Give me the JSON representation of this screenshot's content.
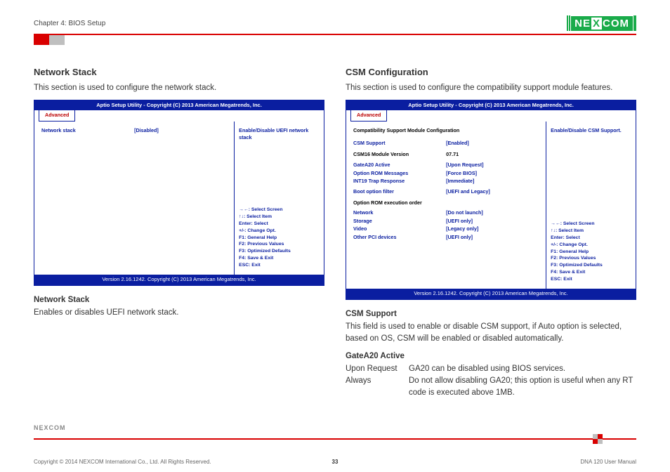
{
  "header": {
    "chapter": "Chapter 4: BIOS Setup",
    "brand_left": "NE",
    "brand_x": "X",
    "brand_right": "COM"
  },
  "left": {
    "title": "Network Stack",
    "intro": "This section is used to configure the network stack.",
    "sub_title": "Network Stack",
    "sub_text": "Enables or disables UEFI network stack."
  },
  "right": {
    "title": "CSM Configuration",
    "intro": "This section is used to configure the compatibility support module features.",
    "sub1_title": "CSM Support",
    "sub1_text": "This field is used to enable or disable CSM support, if Auto option is selected, based on OS, CSM will be enabled or disabled automatically.",
    "sub2_title": "GateA20 Active",
    "kv1_k": "Upon Request",
    "kv1_v": "GA20 can be disabled using BIOS services.",
    "kv2_k": "Always",
    "kv2_v": "Do not allow disabling GA20; this option is useful when any RT code is executed above 1MB."
  },
  "bios_common": {
    "top": "Aptio Setup Utility - Copyright (C) 2013 American Megatrends, Inc.",
    "tab": "Advanced",
    "bottom": "Version 2.16.1242. Copyright (C) 2013 American Megatrends, Inc.",
    "nav": {
      "l1": "→←: Select Screen",
      "l2": "↑↓: Select Item",
      "l3": "Enter: Select",
      "l4": "+/-: Change Opt.",
      "l5": "F1: General Help",
      "l6": "F2: Previous Values",
      "l7": "F3: Optimized Defaults",
      "l8": "F4: Save & Exit",
      "l9": "ESC: Exit"
    }
  },
  "bios_left": {
    "help": "Enable/Disable UEFI network stack",
    "r1_k": "Network stack",
    "r1_v": "[Disabled]"
  },
  "bios_right": {
    "help": "Enable/Disable CSM Support.",
    "heading": "Compatibility Support Module Configuration",
    "r1_k": "CSM Support",
    "r1_v": "[Enabled]",
    "r2_k": "CSM16 Module Version",
    "r2_v": "07.71",
    "r3_k": "GateA20 Active",
    "r3_v": "[Upon Request]",
    "r4_k": "Option ROM Messages",
    "r4_v": "[Force BIOS]",
    "r5_k": "INT19 Trap Response",
    "r5_v": "[Immediate]",
    "r6_k": "Boot option filter",
    "r6_v": "[UEFI and Legacy]",
    "r7_k": "Option ROM execution order",
    "r8_k": "Network",
    "r8_v": "[Do not launch]",
    "r9_k": "Storage",
    "r9_v": "[UEFI only]",
    "r10_k": "Video",
    "r10_v": "[Legacy only]",
    "r11_k": "Other PCI devices",
    "r11_v": "[UEFI only]"
  },
  "footer": {
    "brand": "NE̲XCOM",
    "copyright": "Copyright © 2014 NEXCOM International Co., Ltd. All Rights Reserved.",
    "page": "33",
    "manual": "DNA 120 User Manual"
  }
}
